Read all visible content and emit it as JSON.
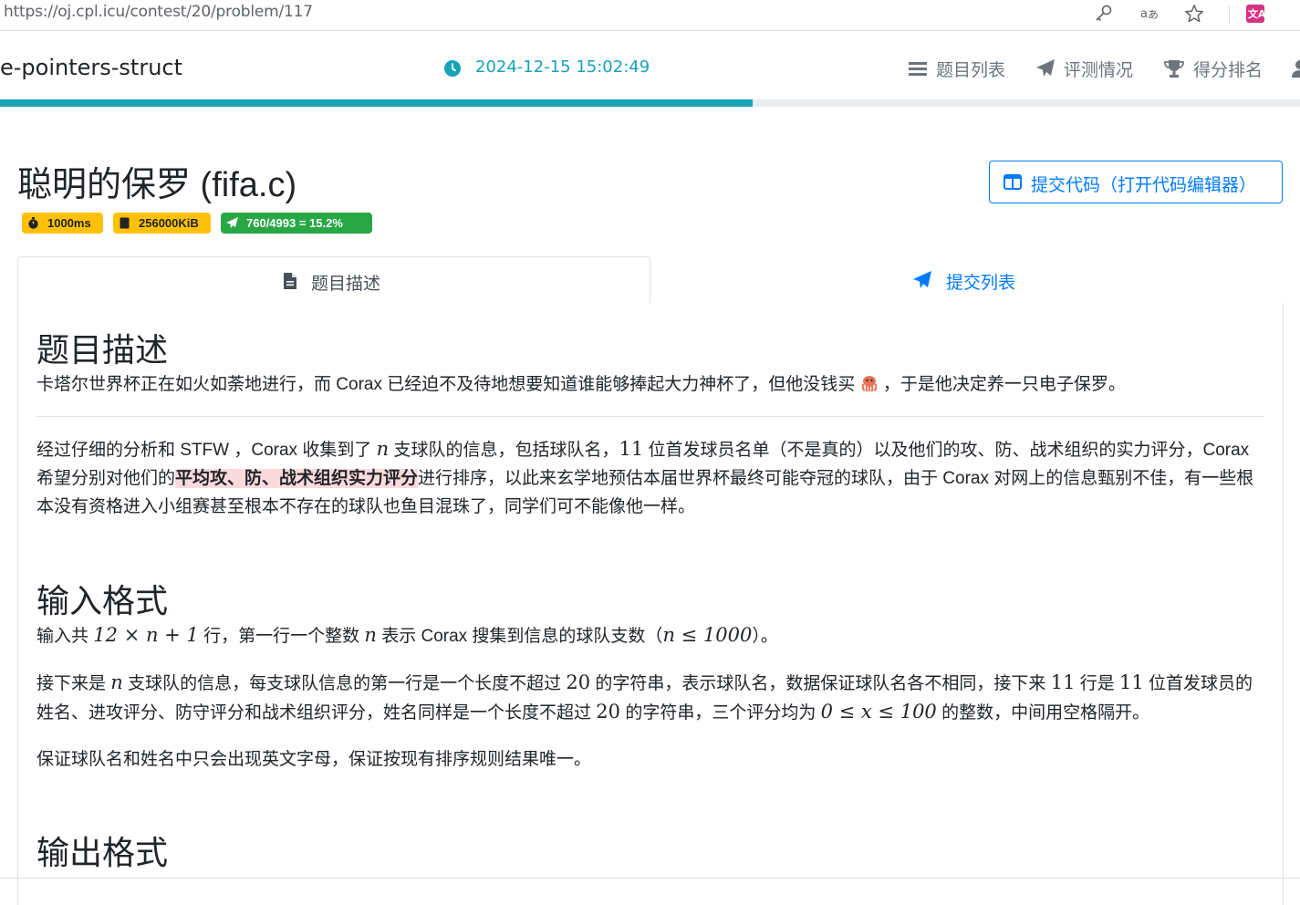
{
  "browser": {
    "url": "https://oj.cpl.icu/contest/20/problem/117",
    "icons": [
      "key-icon",
      "translate-icon",
      "star-icon",
      "extension-translate-icon"
    ]
  },
  "header": {
    "contest_name": "e-pointers-struct",
    "clock": "2024-12-15 15:02:49",
    "nav": {
      "problems": "题目列表",
      "status": "评测情况",
      "ranking": "得分排名"
    },
    "contest_progress": 0.579,
    "colors": {
      "accent": "#17a2b8",
      "primary": "#007bff"
    }
  },
  "problem": {
    "title": "聪明的保罗 (fifa.c)",
    "time_limit": "1000ms",
    "memory_limit": "256000KiB",
    "acceptance": "760/4993 = 15.2%",
    "submit_button": "提交代码（打开代码编辑器）"
  },
  "tabs": {
    "description": "题目描述",
    "submissions": "提交列表"
  },
  "content": {
    "desc_heading": "题目描述",
    "desc_p1_a": "卡塔尔世界杯正在如火如荼地进行，而 Corax 已经迫不及待地想要知道谁能够捧起大力神杯了，但他没钱买",
    "desc_p1_b": "，于是他决定养一只电子保罗。",
    "desc_p2_a": "经过仔细的分析和 STFW ，Corax 收集到了",
    "desc_p2_n": "n",
    "desc_p2_b": "支球队的信息，包括球队名，",
    "desc_p2_11": "11",
    "desc_p2_c": "位首发球员名单（不是真的）以及他们的攻、防、战术组织的实力评分，Corax 希望分别对他们的",
    "desc_p2_hl": "平均攻、防、战术组织实力评分",
    "desc_p2_d": "进行排序，以此来玄学地预估本届世界杯最终可能夺冠的球队，由于 Corax 对网上的信息甄别不佳，有一些根本没有资格进入小组赛甚至根本不存在的球队也鱼目混珠了，同学们可不能像他一样。",
    "input_heading": "输入格式",
    "in_p1_a": "输入共",
    "in_p1_m1": "12 × n + 1",
    "in_p1_b": "行，第一行一个整数",
    "in_p1_n": "n",
    "in_p1_c": "表示 Corax 搜集到信息的球队支数（",
    "in_p1_m2": "n ≤ 1000",
    "in_p1_d": "）。",
    "in_p2_a": "接下来是",
    "in_p2_n": "n",
    "in_p2_b": "支球队的信息，每支球队信息的第一行是一个长度不超过",
    "in_p2_20a": "20",
    "in_p2_c": "的字符串，表示球队名，数据保证球队名各不相同，接下来",
    "in_p2_11a": "11",
    "in_p2_d": "行是",
    "in_p2_11b": "11",
    "in_p2_e": "位首发球员的姓名、进攻评分、防守评分和战术组织评分，姓名同样是一个长度不超过",
    "in_p2_20b": "20",
    "in_p2_f": "的字符串，三个评分均为",
    "in_p2_m": "0 ≤ x ≤ 100",
    "in_p2_g": "的整数，中间用空格隔开。",
    "in_p3": "保证球队名和姓名中只会出现英文字母，保证按现有排序规则结果唯一。",
    "output_heading": "输出格式"
  }
}
